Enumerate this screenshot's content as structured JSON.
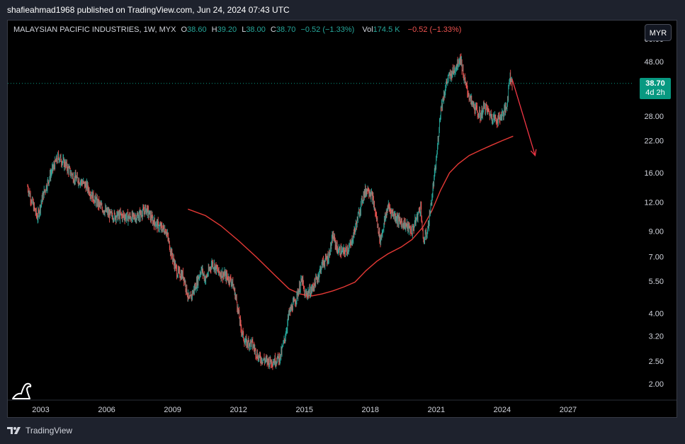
{
  "publisher": "shafieahmad1968 published on TradingView.com, Jun 24, 2024 07:43 UTC",
  "legend": {
    "symbol": "MALAYSIAN PACIFIC INDUSTRIES, 1W, MYX",
    "o_label": "O",
    "o": "38.60",
    "h_label": "H",
    "h": "39.20",
    "l_label": "L",
    "l": "38.00",
    "c_label": "C",
    "c": "38.70",
    "change": "−0.52 (−1.33%)",
    "vol_label": "Vol",
    "vol": "174.5 K",
    "vol_change": "−0.52 (−1.33%)"
  },
  "currency_button": "MYR",
  "price_tag": {
    "price": "38.70",
    "countdown": "4d 2h"
  },
  "footer_brand": "TradingView",
  "colors": {
    "up": "#26a69a",
    "down": "#ef5350",
    "ma": "#e53935",
    "arrow": "#f23645",
    "tag": "#089981",
    "grid": "#2a2e39"
  },
  "chart_data": {
    "type": "candlestick",
    "title": "MALAYSIAN PACIFIC INDUSTRIES, 1W, MYX",
    "y_scale": "log",
    "ylim": [
      1.8,
      60
    ],
    "xlim": [
      2001.5,
      2030
    ],
    "x_ticks": [
      2003,
      2006,
      2009,
      2012,
      2015,
      2018,
      2021,
      2024,
      2027
    ],
    "y_ticks": [
      2.0,
      2.5,
      3.2,
      4.0,
      5.5,
      7.0,
      9.0,
      12.0,
      16.0,
      22.0,
      28.0,
      38.0,
      48.0,
      60.0
    ],
    "y_tick_labels": [
      "2.00",
      "2.50",
      "3.20",
      "4.00",
      "5.50",
      "7.00",
      "9.00",
      "12.00",
      "16.00",
      "22.00",
      "28.00",
      "",
      "48.00",
      "60.00"
    ],
    "last_price": 38.7,
    "price_path": [
      [
        2002.4,
        14.0
      ],
      [
        2002.6,
        12.0
      ],
      [
        2002.85,
        10.3
      ],
      [
        2003.1,
        12.8
      ],
      [
        2003.5,
        16.3
      ],
      [
        2003.8,
        18.8
      ],
      [
        2004.1,
        17.5
      ],
      [
        2004.5,
        15.3
      ],
      [
        2004.8,
        14.8
      ],
      [
        2005.1,
        14.0
      ],
      [
        2005.4,
        12.5
      ],
      [
        2005.8,
        11.3
      ],
      [
        2006.2,
        10.5
      ],
      [
        2006.7,
        10.5
      ],
      [
        2007.1,
        10.3
      ],
      [
        2007.4,
        10.4
      ],
      [
        2007.8,
        11.2
      ],
      [
        2008.1,
        10.0
      ],
      [
        2008.4,
        9.4
      ],
      [
        2008.7,
        9.1
      ],
      [
        2008.95,
        7.2
      ],
      [
        2009.2,
        6.0
      ],
      [
        2009.5,
        5.8
      ],
      [
        2009.75,
        4.5
      ],
      [
        2010.1,
        5.4
      ],
      [
        2010.3,
        6.2
      ],
      [
        2010.5,
        5.6
      ],
      [
        2010.8,
        6.6
      ],
      [
        2011.1,
        6.0
      ],
      [
        2011.4,
        5.8
      ],
      [
        2011.7,
        5.5
      ],
      [
        2011.9,
        4.6
      ],
      [
        2012.1,
        3.5
      ],
      [
        2012.3,
        3.0
      ],
      [
        2012.6,
        3.0
      ],
      [
        2012.9,
        2.6
      ],
      [
        2013.3,
        2.5
      ],
      [
        2013.6,
        2.5
      ],
      [
        2013.9,
        2.6
      ],
      [
        2014.1,
        3.1
      ],
      [
        2014.3,
        4.0
      ],
      [
        2014.6,
        4.6
      ],
      [
        2014.9,
        5.6
      ],
      [
        2015.0,
        4.8
      ],
      [
        2015.3,
        5.0
      ],
      [
        2015.6,
        5.7
      ],
      [
        2015.8,
        6.5
      ],
      [
        2016.1,
        7.0
      ],
      [
        2016.3,
        8.6
      ],
      [
        2016.5,
        7.5
      ],
      [
        2016.8,
        7.3
      ],
      [
        2017.1,
        7.8
      ],
      [
        2017.4,
        10.0
      ],
      [
        2017.7,
        13.0
      ],
      [
        2017.9,
        13.8
      ],
      [
        2018.1,
        12.5
      ],
      [
        2018.3,
        10.0
      ],
      [
        2018.45,
        8.2
      ],
      [
        2018.6,
        9.5
      ],
      [
        2018.8,
        11.5
      ],
      [
        2019.0,
        10.8
      ],
      [
        2019.3,
        10.0
      ],
      [
        2019.6,
        9.6
      ],
      [
        2019.9,
        9.0
      ],
      [
        2020.1,
        10.2
      ],
      [
        2020.3,
        11.6
      ],
      [
        2020.4,
        8.1
      ],
      [
        2020.6,
        9.0
      ],
      [
        2020.8,
        12.5
      ],
      [
        2021.0,
        18.0
      ],
      [
        2021.2,
        30.0
      ],
      [
        2021.3,
        33.0
      ],
      [
        2021.5,
        40.0
      ],
      [
        2021.8,
        44.0
      ],
      [
        2022.1,
        50.0
      ],
      [
        2022.3,
        39.0
      ],
      [
        2022.6,
        32.0
      ],
      [
        2022.8,
        30.0
      ],
      [
        2023.0,
        28.0
      ],
      [
        2023.2,
        31.0
      ],
      [
        2023.5,
        28.0
      ],
      [
        2023.8,
        27.0
      ],
      [
        2024.0,
        28.5
      ],
      [
        2024.2,
        30.5
      ],
      [
        2024.35,
        42.0
      ],
      [
        2024.47,
        38.7
      ]
    ],
    "moving_average": [
      [
        2009.7,
        11.2
      ],
      [
        2010.5,
        10.5
      ],
      [
        2011.2,
        9.5
      ],
      [
        2012.0,
        8.2
      ],
      [
        2012.8,
        7.0
      ],
      [
        2013.6,
        5.9
      ],
      [
        2014.3,
        5.1
      ],
      [
        2014.8,
        4.85
      ],
      [
        2015.3,
        4.75
      ],
      [
        2015.8,
        4.85
      ],
      [
        2016.3,
        5.0
      ],
      [
        2016.8,
        5.2
      ],
      [
        2017.3,
        5.45
      ],
      [
        2017.8,
        6.1
      ],
      [
        2018.3,
        6.7
      ],
      [
        2018.8,
        7.2
      ],
      [
        2019.4,
        7.7
      ],
      [
        2019.9,
        8.3
      ],
      [
        2020.4,
        9.4
      ],
      [
        2020.8,
        11.0
      ],
      [
        2021.2,
        13.5
      ],
      [
        2021.6,
        16.0
      ],
      [
        2022.0,
        17.5
      ],
      [
        2022.5,
        19.0
      ],
      [
        2023.0,
        20.0
      ],
      [
        2023.5,
        21.0
      ],
      [
        2024.0,
        22.0
      ],
      [
        2024.5,
        23.0
      ]
    ],
    "projection_arrow": {
      "from": [
        2024.45,
        40.5
      ],
      "to": [
        2025.5,
        19.0
      ]
    }
  }
}
